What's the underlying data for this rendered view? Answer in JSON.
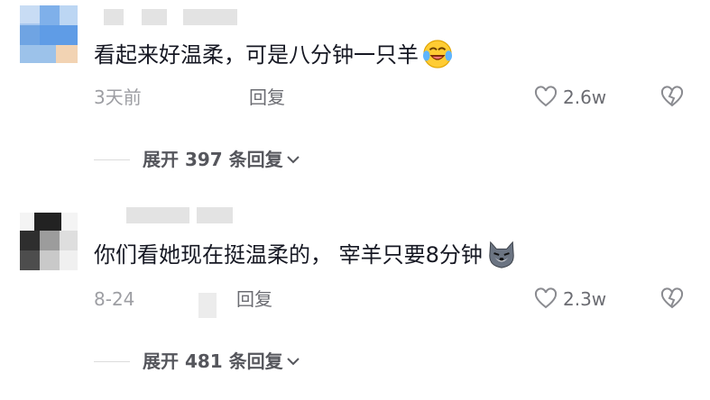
{
  "comments": [
    {
      "text": "看起来好温柔，可是八分钟一只羊",
      "emoji": "laughing-crying-face",
      "time": "3天前",
      "reply_label": "回复",
      "like_count": "2.6w",
      "expand_label": "展开 397 条回复"
    },
    {
      "text": "你们看她现在挺温柔的， 宰羊只要8分钟",
      "emoji": "wolf-face",
      "time": "8-24",
      "reply_label": "回复",
      "like_count": "2.3w",
      "expand_label": "展开 481 条回复"
    }
  ],
  "colors": {
    "text": "#161823",
    "meta": "#9d9ea3",
    "icon": "#8a8b90"
  }
}
